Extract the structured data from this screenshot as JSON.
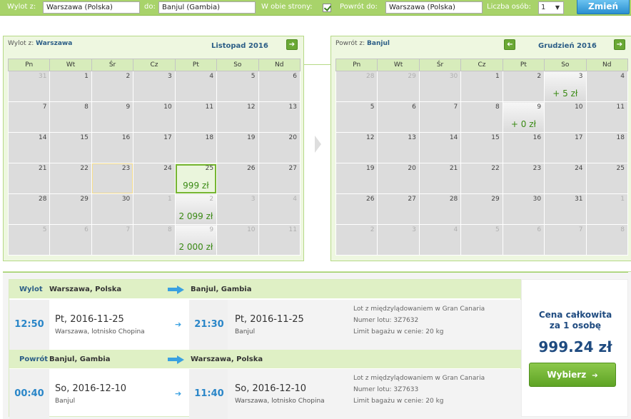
{
  "search": {
    "from_label": "Wylot z:",
    "from_value": "Warszawa (Polska)",
    "to_label": "do:",
    "to_value": "Banjul (Gambia)",
    "both_label": "W obie strony:",
    "return_label": "Powrót do:",
    "return_value": "Warszawa (Polska)",
    "persons_label": "Liczba osób:",
    "persons_value": "1",
    "change_button": "Zmień"
  },
  "left_calendar": {
    "title_prefix": "Wylot z:",
    "title_city": "Warszawa",
    "month": "Listopad 2016",
    "weekdays": [
      "Pn",
      "Wt",
      "Śr",
      "Cz",
      "Pt",
      "So",
      "Nd"
    ],
    "weeks": [
      [
        {
          "d": "31",
          "m": true
        },
        {
          "d": "1"
        },
        {
          "d": "2"
        },
        {
          "d": "3"
        },
        {
          "d": "4"
        },
        {
          "d": "5"
        },
        {
          "d": "6"
        }
      ],
      [
        {
          "d": "7"
        },
        {
          "d": "8"
        },
        {
          "d": "9"
        },
        {
          "d": "10"
        },
        {
          "d": "11"
        },
        {
          "d": "12"
        },
        {
          "d": "13"
        }
      ],
      [
        {
          "d": "14"
        },
        {
          "d": "15"
        },
        {
          "d": "16"
        },
        {
          "d": "17"
        },
        {
          "d": "18"
        },
        {
          "d": "19"
        },
        {
          "d": "20"
        }
      ],
      [
        {
          "d": "21"
        },
        {
          "d": "22"
        },
        {
          "d": "23",
          "today": true
        },
        {
          "d": "24"
        },
        {
          "d": "25",
          "price": "999 zł",
          "sel": true
        },
        {
          "d": "26"
        },
        {
          "d": "27"
        }
      ],
      [
        {
          "d": "28"
        },
        {
          "d": "29"
        },
        {
          "d": "30"
        },
        {
          "d": "1",
          "m": true
        },
        {
          "d": "2",
          "m": true,
          "price": "2 099 zł",
          "hl": true
        },
        {
          "d": "3",
          "m": true
        },
        {
          "d": "4",
          "m": true
        }
      ],
      [
        {
          "d": "5",
          "m": true
        },
        {
          "d": "6",
          "m": true
        },
        {
          "d": "7",
          "m": true
        },
        {
          "d": "8",
          "m": true
        },
        {
          "d": "9",
          "m": true,
          "price": "2 000 zł",
          "hl": true
        },
        {
          "d": "10",
          "m": true
        },
        {
          "d": "11",
          "m": true
        }
      ]
    ]
  },
  "right_calendar": {
    "title_prefix": "Powrót z:",
    "title_city": "Banjul",
    "month": "Grudzień 2016",
    "weekdays": [
      "Pn",
      "Wt",
      "Śr",
      "Cz",
      "Pt",
      "So",
      "Nd"
    ],
    "weeks": [
      [
        {
          "d": "28",
          "m": true
        },
        {
          "d": "29",
          "m": true
        },
        {
          "d": "30",
          "m": true
        },
        {
          "d": "1"
        },
        {
          "d": "2"
        },
        {
          "d": "3",
          "price": "+ 5 zł",
          "hl": true
        },
        {
          "d": "4"
        }
      ],
      [
        {
          "d": "5"
        },
        {
          "d": "6"
        },
        {
          "d": "7"
        },
        {
          "d": "8"
        },
        {
          "d": "9",
          "price": "+ 0 zł",
          "hl": true
        },
        {
          "d": "10"
        },
        {
          "d": "11"
        }
      ],
      [
        {
          "d": "12"
        },
        {
          "d": "13"
        },
        {
          "d": "14"
        },
        {
          "d": "15"
        },
        {
          "d": "16"
        },
        {
          "d": "17"
        },
        {
          "d": "18"
        }
      ],
      [
        {
          "d": "19"
        },
        {
          "d": "20"
        },
        {
          "d": "21"
        },
        {
          "d": "22"
        },
        {
          "d": "23"
        },
        {
          "d": "24"
        },
        {
          "d": "25"
        }
      ],
      [
        {
          "d": "26"
        },
        {
          "d": "27"
        },
        {
          "d": "28"
        },
        {
          "d": "29"
        },
        {
          "d": "30"
        },
        {
          "d": "31"
        },
        {
          "d": "1",
          "m": true
        }
      ],
      [
        {
          "d": "2",
          "m": true
        },
        {
          "d": "3",
          "m": true
        },
        {
          "d": "4",
          "m": true
        },
        {
          "d": "5",
          "m": true
        },
        {
          "d": "6",
          "m": true
        },
        {
          "d": "7",
          "m": true
        },
        {
          "d": "8",
          "m": true
        }
      ]
    ]
  },
  "outbound": {
    "label": "Wylot",
    "from": "Warszawa, Polska",
    "to": "Banjul, Gambia",
    "dep_time": "12:50",
    "dep_date": "Pt, 2016-11-25",
    "dep_place": "Warszawa, lotnisko Chopina",
    "arr_time": "21:30",
    "arr_date": "Pt, 2016-11-25",
    "arr_place": "Banjul",
    "info1": "Lot z międzylądowaniem w Gran Canaria",
    "info2": "Numer lotu: 3Z7632",
    "info3": "Limit bagażu w cenie: 20 kg"
  },
  "inbound": {
    "label": "Powrót",
    "from": "Banjul, Gambia",
    "to": "Warszawa, Polska",
    "dep_time": "00:40",
    "dep_date": "So, 2016-12-10",
    "dep_place": "Banjul",
    "arr_time": "11:40",
    "arr_date": "So, 2016-12-10",
    "arr_place": "Warszawa, lotnisko Chopina",
    "info1": "Lot z międzylądowaniem w Gran Canaria",
    "info2": "Numer lotu: 3Z7633",
    "info3": "Limit bagażu w cenie: 20 kg"
  },
  "total": {
    "label_line1": "Cena całkowita",
    "label_line2": "za 1 osobę",
    "price": "999.24 zł",
    "choose_button": "Wybierz"
  },
  "icons": {
    "arrow_right": "arrow-right-icon",
    "arrow_left": "arrow-left-icon",
    "chevron_down": "chevron-down-icon",
    "checkmark": "checkmark-icon"
  },
  "colors": {
    "accent_green": "#a8d36a",
    "price_green": "#3a8a14",
    "time_blue": "#2a86c8",
    "total_blue": "#1f4b80",
    "change_blue": "#2a8fd0"
  }
}
